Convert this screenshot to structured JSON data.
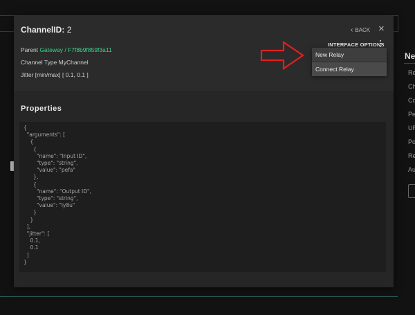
{
  "background": {
    "side_panel": {
      "heading": "Net",
      "items": [
        "Re",
        "Ch",
        "Co",
        "Pe",
        "UR",
        "Po",
        "Re",
        "Au"
      ]
    }
  },
  "modal": {
    "title_label": "ChannelID:",
    "title_value": "2",
    "back_label": "BACK",
    "close_icon": "×",
    "parent_label": "Parent",
    "parent_link": "Gateway / F7f8b9f859f3a11",
    "channel_type": "Channel Type MyChannel",
    "jitter": "Jitter [min/max] [ 0.1, 0.1 ]",
    "interface_options_label": "INTERFACE OPTIONS",
    "properties_title": "Properties",
    "properties_json": "{\n  \"arguments\": [\n    {\n      {\n        \"name\": \"Input ID\",\n        \"type\": \"string\",\n        \"value\": \"pefa\"\n      },\n      {\n        \"name\": \"Output ID\",\n        \"type\": \"string\",\n        \"value\": \"ly8u\"\n      }\n    }\n  ],\n  \"jitter\": [\n    0.1,\n    0.1\n  ]\n}"
  },
  "dropdown": {
    "items": [
      {
        "label": "New Relay"
      },
      {
        "label": "Connect Relay"
      }
    ]
  },
  "colors": {
    "accent_link": "#3dd68c",
    "arrow": "#e02020"
  },
  "icons": {
    "back": "chevron-left-icon",
    "close": "close-icon",
    "menu": "kebab-menu-icon",
    "annotation": "red-arrow-icon"
  }
}
